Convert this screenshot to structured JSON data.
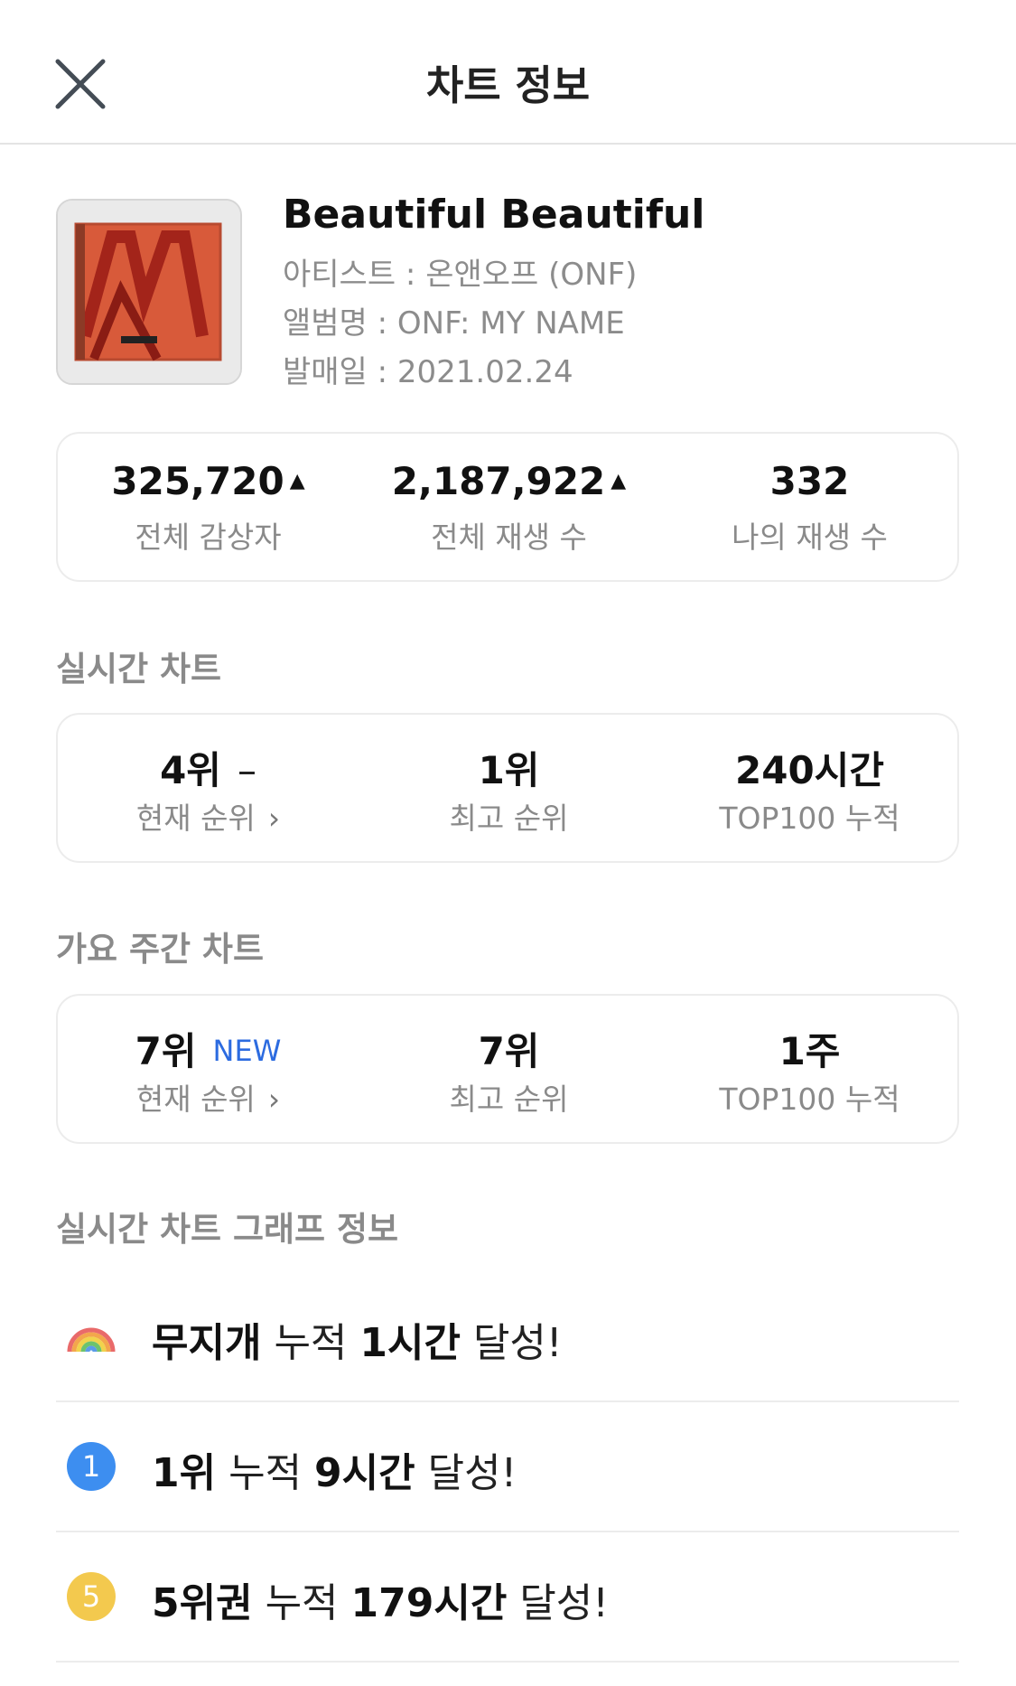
{
  "header": {
    "title": "차트 정보"
  },
  "song": {
    "title": "Beautiful Beautiful",
    "artist": "아티스트 : 온앤오프 (ONF)",
    "album": "앨범명 : ONF: MY NAME",
    "release": "발매일 : 2021.02.24"
  },
  "stats": {
    "listeners": {
      "value": "325,720",
      "label": "전체 감상자",
      "trend": "up"
    },
    "plays": {
      "value": "2,187,922",
      "label": "전체 재생 수",
      "trend": "up"
    },
    "my_plays": {
      "value": "332",
      "label": "나의 재생 수"
    }
  },
  "realtime": {
    "section_title": "실시간 차트",
    "current": {
      "value": "4위",
      "change": "–",
      "label": "현재 순위"
    },
    "best": {
      "value": "1위",
      "label": "최고 순위"
    },
    "top100": {
      "value": "240시간",
      "label": "TOP100 누적"
    }
  },
  "weekly": {
    "section_title": "가요 주간 차트",
    "current": {
      "value": "7위",
      "badge": "NEW",
      "label": "현재 순위"
    },
    "best": {
      "value": "7위",
      "label": "최고 순위"
    },
    "top100": {
      "value": "1주",
      "label": "TOP100 누적"
    }
  },
  "graph": {
    "section_title": "실시간 차트 그래프 정보",
    "items": [
      {
        "icon": "rainbow-icon",
        "b1": "무지개",
        "t1": " 누적 ",
        "b2": "1시간",
        "t2": " 달성!"
      },
      {
        "icon": "rank-1-badge-icon",
        "badge": "1",
        "badge_color": "#3d8ef0",
        "b1": "1위",
        "t1": " 누적 ",
        "b2": "9시간",
        "t2": " 달성!"
      },
      {
        "icon": "rank-5-badge-icon",
        "badge": "5",
        "badge_color": "#f3c94e",
        "b1": "5위권",
        "t1": " 누적 ",
        "b2": "179시간",
        "t2": " 달성!"
      }
    ]
  },
  "colors": {
    "accent_new": "#2c6be0",
    "rank1": "#3d8ef0",
    "rank5": "#f3c94e"
  }
}
